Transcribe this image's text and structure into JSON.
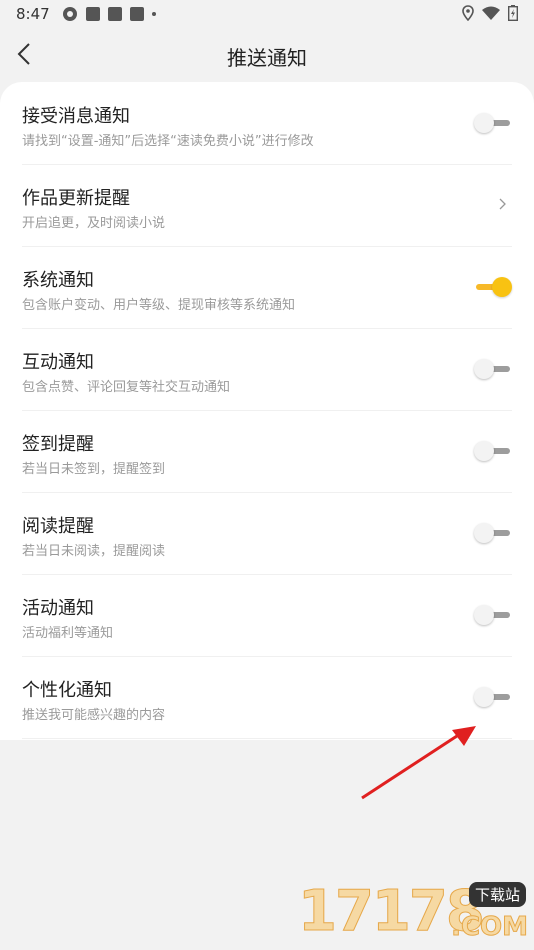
{
  "status_bar": {
    "time": "8:47"
  },
  "header": {
    "title": "推送通知"
  },
  "settings": [
    {
      "title": "接受消息通知",
      "subtitle": "请找到“设置-通知”后选择“速读免费小说”进行修改",
      "control": "toggle",
      "on": false
    },
    {
      "title": "作品更新提醒",
      "subtitle": "开启追更，及时阅读小说",
      "control": "chevron"
    },
    {
      "title": "系统通知",
      "subtitle": "包含账户变动、用户等级、提现审核等系统通知",
      "control": "toggle",
      "on": true
    },
    {
      "title": "互动通知",
      "subtitle": "包含点赞、评论回复等社交互动通知",
      "control": "toggle",
      "on": false
    },
    {
      "title": "签到提醒",
      "subtitle": "若当日未签到，提醒签到",
      "control": "toggle",
      "on": false
    },
    {
      "title": "阅读提醒",
      "subtitle": "若当日未阅读，提醒阅读",
      "control": "toggle",
      "on": false
    },
    {
      "title": "活动通知",
      "subtitle": "活动福利等通知",
      "control": "toggle",
      "on": false
    },
    {
      "title": "个性化通知",
      "subtitle": "推送我可能感兴趣的内容",
      "control": "toggle",
      "on": false
    }
  ],
  "watermark": {
    "number": "17178",
    "badge": "下载站",
    "com": ".COM"
  },
  "colors": {
    "toggle_on": "#f8c212",
    "annotation_arrow": "#e02020"
  }
}
